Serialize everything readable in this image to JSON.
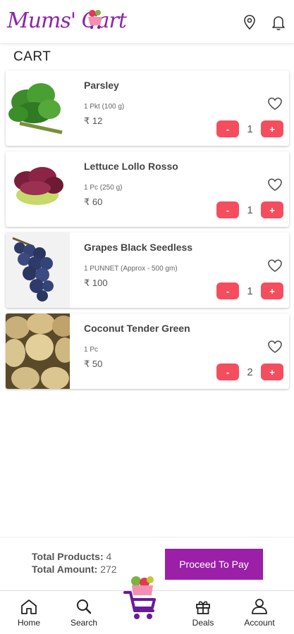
{
  "header": {
    "logo_text": "Mums' Cart",
    "icons": [
      "location-pin-icon",
      "bell-icon"
    ]
  },
  "page": {
    "title": "CART"
  },
  "cart": {
    "items": [
      {
        "name": "Parsley",
        "quantity_text": "1 Pkt (100 g)",
        "price": "₹ 12",
        "count": "1",
        "minus": "-",
        "plus": "+"
      },
      {
        "name": "Lettuce Lollo Rosso",
        "quantity_text": "1 Pc (250 g)",
        "price": "₹ 60",
        "count": "1",
        "minus": "-",
        "plus": "+"
      },
      {
        "name": "Grapes Black Seedless",
        "quantity_text": "1 PUNNET (Approx - 500 gm)",
        "price": "₹ 100",
        "count": "1",
        "minus": "-",
        "plus": "+"
      },
      {
        "name": "Coconut Tender Green",
        "quantity_text": "1 Pc",
        "price": "₹ 50",
        "count": "2",
        "minus": "-",
        "plus": "+"
      }
    ]
  },
  "summary": {
    "total_products_label": "Total Products:",
    "total_products_value": "4",
    "total_amount_label": "Total Amount:",
    "total_amount_value": "272",
    "proceed_label": "Proceed To Pay"
  },
  "nav": {
    "items": [
      {
        "label": "Home",
        "icon": "home-icon"
      },
      {
        "label": "Search",
        "icon": "search-icon"
      },
      {
        "label": "",
        "icon": "cart-icon"
      },
      {
        "label": "Deals",
        "icon": "gift-icon"
      },
      {
        "label": "Account",
        "icon": "user-icon"
      }
    ]
  },
  "colors": {
    "brand": "#9c1fa8",
    "accent": "#f44e5e"
  }
}
